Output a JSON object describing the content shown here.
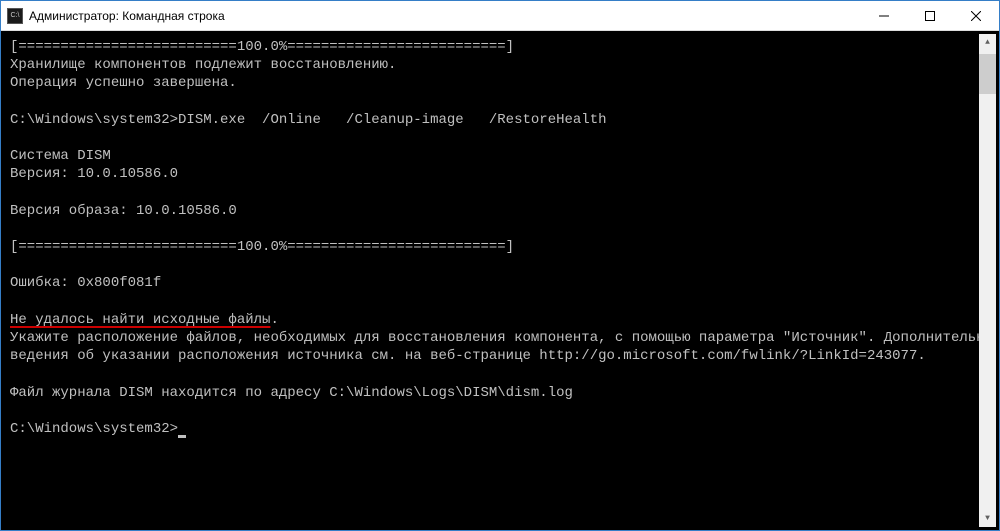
{
  "title": "Администратор: Командная строка",
  "lines": {
    "l0": "[==========================100.0%==========================]",
    "l1": "Хранилище компонентов подлежит восстановлению.",
    "l2": "Операция успешно завершена.",
    "l3": "",
    "l4": "C:\\Windows\\system32>DISM.exe  /Online   /Cleanup-image   /RestoreHealth",
    "l5": "",
    "l6": "Система DISM",
    "l7": "Версия: 10.0.10586.0",
    "l8": "",
    "l9": "Версия образа: 10.0.10586.0",
    "l10": "",
    "l11": "[==========================100.0%==========================]",
    "l12": "",
    "l13": "Ошибка: 0x800f081f",
    "l14": "",
    "l15_underlined": "Не удалось найти исходные файлы",
    "l15_suffix": ".",
    "l16": "Укажите расположение файлов, необходимых для восстановления компонента, с помощью параметра \"Источник\". Дополнительные с",
    "l17": "ведения об указании расположения источника см. на веб-странице http://go.microsoft.com/fwlink/?LinkId=243077.",
    "l18": "",
    "l19": "Файл журнала DISM находится по адресу C:\\Windows\\Logs\\DISM\\dism.log",
    "l20": "",
    "l21": "C:\\Windows\\system32>"
  }
}
